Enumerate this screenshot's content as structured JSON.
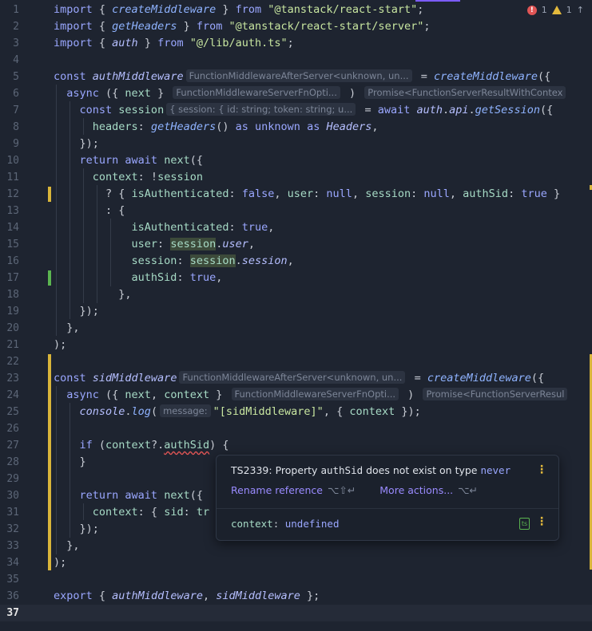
{
  "status": {
    "errors": "1",
    "warnings": "1",
    "arrow": "↑"
  },
  "lines": [
    {
      "n": "1",
      "tokens": [
        [
          "import",
          "kw"
        ],
        [
          " { ",
          "punc"
        ],
        [
          "createMiddleware",
          "fn"
        ],
        [
          " } ",
          "punc"
        ],
        [
          "from",
          "kw"
        ],
        [
          " ",
          "plain"
        ],
        [
          "\"@tanstack/react-start\"",
          "str"
        ],
        [
          ";",
          "punc"
        ]
      ]
    },
    {
      "n": "2",
      "tokens": [
        [
          "import",
          "kw"
        ],
        [
          " { ",
          "punc"
        ],
        [
          "getHeaders",
          "fn"
        ],
        [
          " } ",
          "punc"
        ],
        [
          "from",
          "kw"
        ],
        [
          " ",
          "plain"
        ],
        [
          "\"@tanstack/react-start/server\"",
          "str"
        ],
        [
          ";",
          "punc"
        ]
      ]
    },
    {
      "n": "3",
      "tokens": [
        [
          "import",
          "kw"
        ],
        [
          " { ",
          "punc"
        ],
        [
          "auth",
          "var"
        ],
        [
          " } ",
          "punc"
        ],
        [
          "from",
          "kw"
        ],
        [
          " ",
          "plain"
        ],
        [
          "\"@/lib/auth.ts\"",
          "str"
        ],
        [
          ";",
          "punc"
        ]
      ]
    },
    {
      "n": "4",
      "tokens": []
    },
    {
      "n": "5",
      "tokens": [
        [
          "const",
          "kw"
        ],
        [
          " ",
          "plain"
        ],
        [
          "authMiddleware",
          "var"
        ],
        [
          "FunctionMiddlewareAfterServer<unknown, un...",
          "hint"
        ],
        [
          " = ",
          "punc"
        ],
        [
          "createMiddleware",
          "fn"
        ],
        [
          "({",
          "punc"
        ]
      ]
    },
    {
      "n": "6",
      "tokens": [
        [
          "  async",
          "kw"
        ],
        [
          " ({ ",
          "punc"
        ],
        [
          "next",
          "prop"
        ],
        [
          " } ",
          "punc"
        ],
        [
          "FunctionMiddlewareServerFnOpti...",
          "hint"
        ],
        [
          " ) ",
          "punc"
        ],
        [
          "Promise<FunctionServerResultWithContex",
          "hint"
        ]
      ]
    },
    {
      "n": "7",
      "tokens": [
        [
          "    const",
          "kw"
        ],
        [
          " ",
          "plain"
        ],
        [
          "session",
          "prop"
        ],
        [
          "{ session: { id: string; token: string; u...",
          "hint"
        ],
        [
          " = ",
          "punc"
        ],
        [
          "await",
          "kw"
        ],
        [
          " ",
          "plain"
        ],
        [
          "auth",
          "var"
        ],
        [
          ".",
          "punc"
        ],
        [
          "api",
          "var"
        ],
        [
          ".",
          "punc"
        ],
        [
          "getSession",
          "fn"
        ],
        [
          "({",
          "punc"
        ]
      ]
    },
    {
      "n": "8",
      "tokens": [
        [
          "      headers",
          "prop"
        ],
        [
          ": ",
          "punc"
        ],
        [
          "getHeaders",
          "fn"
        ],
        [
          "() ",
          "punc"
        ],
        [
          "as",
          "kw"
        ],
        [
          " ",
          "plain"
        ],
        [
          "unknown",
          "kw"
        ],
        [
          " ",
          "plain"
        ],
        [
          "as",
          "kw"
        ],
        [
          " ",
          "plain"
        ],
        [
          "Headers",
          "var"
        ],
        [
          ",",
          "punc"
        ]
      ]
    },
    {
      "n": "9",
      "tokens": [
        [
          "    });",
          "punc"
        ]
      ]
    },
    {
      "n": "10",
      "tokens": [
        [
          "    return",
          "kw"
        ],
        [
          " ",
          "plain"
        ],
        [
          "await",
          "kw"
        ],
        [
          " ",
          "plain"
        ],
        [
          "next",
          "prop"
        ],
        [
          "({",
          "punc"
        ]
      ]
    },
    {
      "n": "11",
      "tokens": [
        [
          "      context",
          "prop"
        ],
        [
          ": !",
          "punc"
        ],
        [
          "session",
          "prop"
        ]
      ]
    },
    {
      "n": "12",
      "tokens": [
        [
          "        ? { ",
          "punc"
        ],
        [
          "isAuthenticated",
          "prop"
        ],
        [
          ": ",
          "punc"
        ],
        [
          "false",
          "kw"
        ],
        [
          ", ",
          "punc"
        ],
        [
          "user",
          "prop"
        ],
        [
          ": ",
          "punc"
        ],
        [
          "null",
          "kw"
        ],
        [
          ", ",
          "punc"
        ],
        [
          "session",
          "prop"
        ],
        [
          ": ",
          "punc"
        ],
        [
          "null",
          "kw"
        ],
        [
          ", ",
          "punc"
        ],
        [
          "authSid",
          "prop"
        ],
        [
          ": ",
          "punc"
        ],
        [
          "true",
          "kw"
        ],
        [
          " }",
          "punc"
        ]
      ]
    },
    {
      "n": "13",
      "tokens": [
        [
          "        : {",
          "punc"
        ]
      ]
    },
    {
      "n": "14",
      "tokens": [
        [
          "            isAuthenticated",
          "prop"
        ],
        [
          ": ",
          "punc"
        ],
        [
          "true",
          "kw"
        ],
        [
          ",",
          "punc"
        ]
      ]
    },
    {
      "n": "15",
      "tokens": [
        [
          "            user",
          "prop"
        ],
        [
          ": ",
          "punc"
        ],
        [
          "session",
          "hlprop"
        ],
        [
          ".",
          "punc"
        ],
        [
          "user",
          "var"
        ],
        [
          ",",
          "punc"
        ]
      ]
    },
    {
      "n": "16",
      "tokens": [
        [
          "            session",
          "prop"
        ],
        [
          ": ",
          "punc"
        ],
        [
          "session",
          "hlprop"
        ],
        [
          ".",
          "punc"
        ],
        [
          "session",
          "var"
        ],
        [
          ",",
          "punc"
        ]
      ]
    },
    {
      "n": "17",
      "tokens": [
        [
          "            authSid",
          "prop"
        ],
        [
          ": ",
          "punc"
        ],
        [
          "true",
          "kw"
        ],
        [
          ",",
          "punc"
        ]
      ]
    },
    {
      "n": "18",
      "tokens": [
        [
          "          },",
          "punc"
        ]
      ]
    },
    {
      "n": "19",
      "tokens": [
        [
          "    });",
          "punc"
        ]
      ]
    },
    {
      "n": "20",
      "tokens": [
        [
          "  },",
          "punc"
        ]
      ]
    },
    {
      "n": "21",
      "tokens": [
        [
          ");",
          "punc"
        ]
      ]
    },
    {
      "n": "22",
      "tokens": []
    },
    {
      "n": "23",
      "tokens": [
        [
          "const",
          "kw"
        ],
        [
          " ",
          "plain"
        ],
        [
          "sidMiddleware",
          "var"
        ],
        [
          "FunctionMiddlewareAfterServer<unknown, un...",
          "hint"
        ],
        [
          " = ",
          "punc"
        ],
        [
          "createMiddleware",
          "fn"
        ],
        [
          "({ ",
          "punc"
        ]
      ]
    },
    {
      "n": "24",
      "tokens": [
        [
          "  async",
          "kw"
        ],
        [
          " ({ ",
          "punc"
        ],
        [
          "next",
          "prop"
        ],
        [
          ", ",
          "punc"
        ],
        [
          "context",
          "prop"
        ],
        [
          " } ",
          "punc"
        ],
        [
          "FunctionMiddlewareServerFnOpti...",
          "hint"
        ],
        [
          " ) ",
          "punc"
        ],
        [
          "Promise<FunctionServerResul",
          "hint"
        ]
      ]
    },
    {
      "n": "25",
      "tokens": [
        [
          "    console",
          "var"
        ],
        [
          ".",
          "punc"
        ],
        [
          "log",
          "fn"
        ],
        [
          "(",
          "punc"
        ],
        [
          "message:",
          "hint"
        ],
        [
          "\"[sidMiddleware]\"",
          "str"
        ],
        [
          ", { ",
          "punc"
        ],
        [
          "context",
          "prop"
        ],
        [
          " });",
          "punc"
        ]
      ]
    },
    {
      "n": "26",
      "tokens": []
    },
    {
      "n": "27",
      "tokens": [
        [
          "    if",
          "kw"
        ],
        [
          " (",
          "punc"
        ],
        [
          "context",
          "prop"
        ],
        [
          "?.",
          "punc"
        ],
        [
          "authSid",
          "errprop"
        ],
        [
          ") {",
          "punc"
        ]
      ]
    },
    {
      "n": "28",
      "tokens": [
        [
          "    }",
          "punc"
        ]
      ]
    },
    {
      "n": "29",
      "tokens": []
    },
    {
      "n": "30",
      "tokens": [
        [
          "    return",
          "kw"
        ],
        [
          " ",
          "plain"
        ],
        [
          "await",
          "kw"
        ],
        [
          " ",
          "plain"
        ],
        [
          "next",
          "prop"
        ],
        [
          "({",
          "punc"
        ]
      ]
    },
    {
      "n": "31",
      "tokens": [
        [
          "      context",
          "prop"
        ],
        [
          ": { ",
          "punc"
        ],
        [
          "sid",
          "prop"
        ],
        [
          ": ",
          "punc"
        ],
        [
          "tr",
          "prop"
        ]
      ]
    },
    {
      "n": "32",
      "tokens": [
        [
          "    });",
          "punc"
        ]
      ]
    },
    {
      "n": "33",
      "tokens": [
        [
          "  },",
          "punc"
        ]
      ]
    },
    {
      "n": "34",
      "tokens": [
        [
          ");",
          "punc"
        ]
      ]
    },
    {
      "n": "35",
      "tokens": []
    },
    {
      "n": "36",
      "tokens": [
        [
          "export",
          "kw"
        ],
        [
          " { ",
          "punc"
        ],
        [
          "authMiddleware",
          "var"
        ],
        [
          ", ",
          "punc"
        ],
        [
          "sidMiddleware",
          "var"
        ],
        [
          " };",
          "punc"
        ]
      ]
    },
    {
      "n": "37",
      "tokens": []
    }
  ],
  "popup": {
    "prefix": "TS2339: Property ",
    "prop": "authSid",
    "middle": " does not exist on type ",
    "type": "never",
    "rename": "Rename reference",
    "rename_sc": "⌥⇧↵",
    "more": "More actions...",
    "more_sc": "⌥↵",
    "ctx_key": "context",
    "ctx_sep": ": ",
    "ctx_val": "undefined"
  }
}
